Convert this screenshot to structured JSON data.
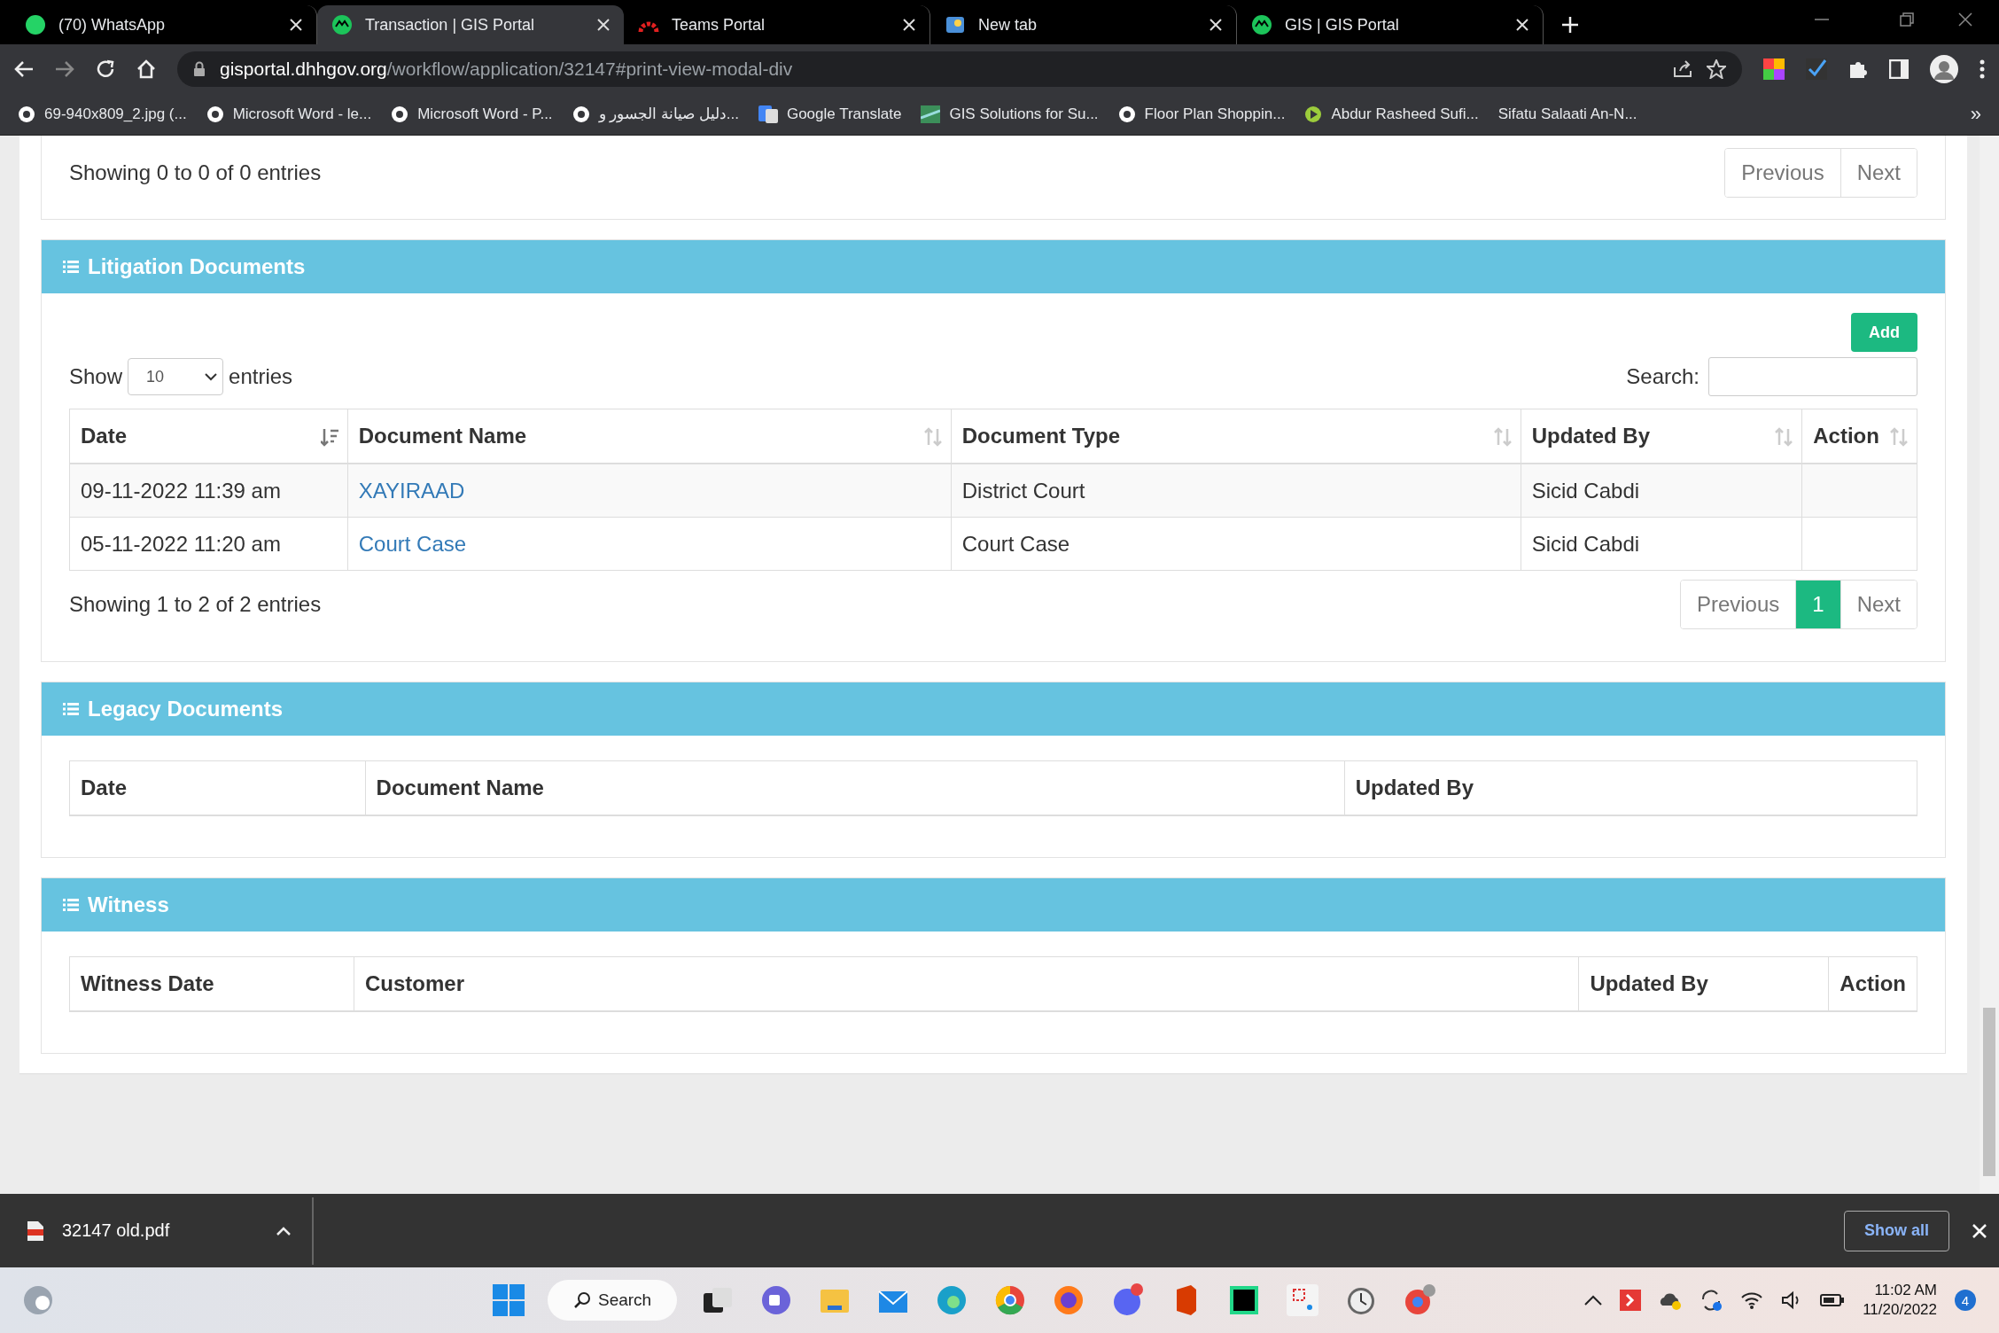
{
  "browser": {
    "tabs": [
      {
        "title": "(70) WhatsApp",
        "selected": false
      },
      {
        "title": "Transaction | GIS Portal",
        "selected": true
      },
      {
        "title": "Teams Portal",
        "selected": false
      },
      {
        "title": "New tab",
        "selected": false
      },
      {
        "title": "GIS | GIS Portal",
        "selected": false
      }
    ],
    "address": {
      "domain": "gisportal.dhhgov.org",
      "path": "/workflow/application/32147#print-view-modal-div"
    },
    "bookmarks": [
      "69-940x809_2.jpg (...",
      "Microsoft Word - le...",
      "Microsoft Word - P...",
      "دليل صيانة الجسور و...",
      "Google Translate",
      "GIS Solutions for Su...",
      "Floor Plan Shoppin...",
      "Abdur Rasheed Sufi...",
      "Sifatu Salaati An-N..."
    ],
    "more": "»"
  },
  "top_panel": {
    "info": "Showing 0 to 0 of 0 entries",
    "pagination": [
      {
        "label": "Previous",
        "selected": false,
        "disabled": true
      },
      {
        "label": "Next",
        "selected": false,
        "disabled": true
      }
    ]
  },
  "sections": [
    {
      "title": "Litigation Documents",
      "add_button": "Add",
      "length": {
        "label_before": "Show",
        "value": "10",
        "label_after": "entries"
      },
      "search_label": "Search:",
      "columns": [
        "Date",
        "Document Name",
        "Document Type",
        "Updated By",
        "Action"
      ],
      "rows": [
        [
          "09-11-2022 11:39 am",
          "XAYIRAAD",
          "District Court",
          "Sicid Cabdi",
          ""
        ],
        [
          "05-11-2022 11:20 am",
          "Court Case",
          "Court Case",
          "Sicid Cabdi",
          ""
        ]
      ],
      "info": "Showing 1 to 2 of 2 entries",
      "pagination": [
        {
          "label": "Previous",
          "selected": false,
          "disabled": true
        },
        {
          "label": "1",
          "selected": true,
          "disabled": false
        },
        {
          "label": "Next",
          "selected": false,
          "disabled": true
        }
      ]
    },
    {
      "title": "Legacy Documents",
      "columns": [
        "Date",
        "Document Name",
        "Updated By"
      ]
    },
    {
      "title": "Witness",
      "columns": [
        "Witness Date",
        "Customer",
        "Updated By",
        "Action"
      ]
    }
  ],
  "download_bar": {
    "file": "32147 old.pdf",
    "show_all": "Show all"
  },
  "taskbar": {
    "search": "Search",
    "time": "11:02 AM",
    "date": "11/20/2022",
    "notifications": "4"
  }
}
